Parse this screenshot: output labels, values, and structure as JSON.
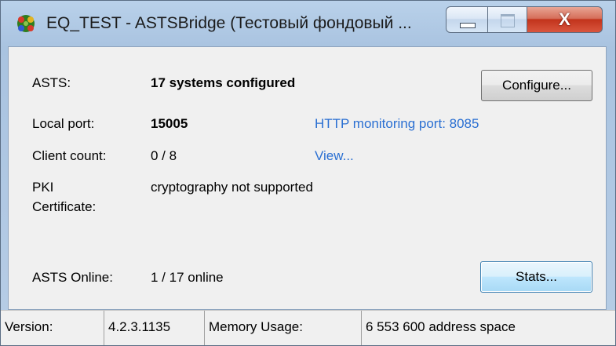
{
  "window": {
    "title": "EQ_TEST - ASTSBridge (Тестовый фондовый ...",
    "icon": "puzzle-app-icon",
    "controls": {
      "minimize": "minimize-icon",
      "maximize": "maximize-icon",
      "close": "X"
    }
  },
  "rows": {
    "asts": {
      "label": "ASTS:",
      "value": "17 systems configured"
    },
    "local_port": {
      "label": "Local port:",
      "value": "15005",
      "link": "HTTP monitoring port: 8085"
    },
    "client_count": {
      "label": "Client count:",
      "value": "0 / 8",
      "link": "View..."
    },
    "pki": {
      "label_line1": "PKI",
      "label_line2": "Certificate:",
      "value": "cryptography not supported"
    },
    "asts_online": {
      "label": "ASTS Online:",
      "value": "1 / 17 online"
    }
  },
  "buttons": {
    "configure": "Configure...",
    "stats": "Stats..."
  },
  "statusbar": {
    "version_label": "Version:",
    "version_value": "4.2.3.1135",
    "memory_label": "Memory Usage:",
    "memory_value": "6 553 600 address space"
  },
  "colors": {
    "link": "#2a6fd2",
    "close_button": "#c2341c",
    "frame": "#b9d1ea"
  }
}
